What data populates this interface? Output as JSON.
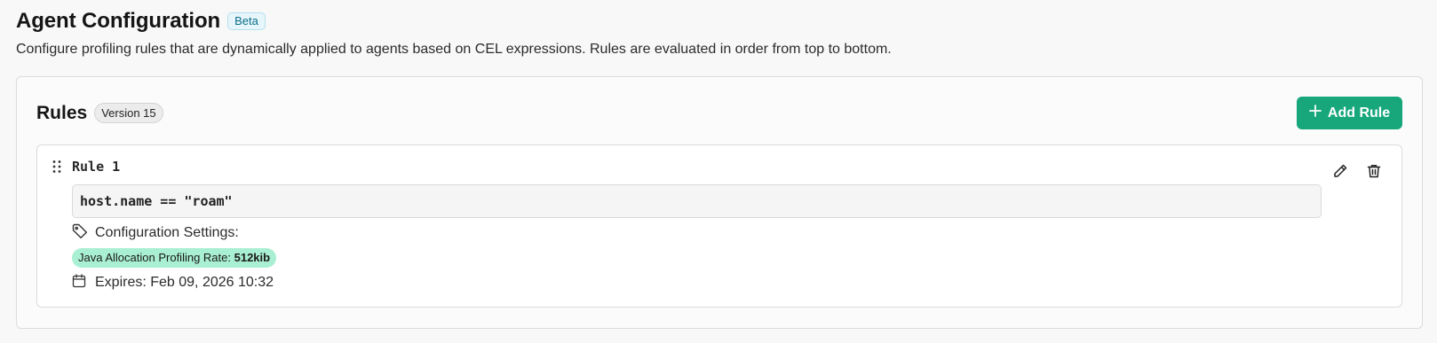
{
  "header": {
    "title": "Agent Configuration",
    "badge": "Beta",
    "description": "Configure profiling rules that are dynamically applied to agents based on CEL expressions. Rules are evaluated in order from top to bottom."
  },
  "rules_section": {
    "title": "Rules",
    "version_label": "Version 15",
    "add_button_label": "Add Rule",
    "rules": [
      {
        "name": "Rule 1",
        "expression": "host.name == \"roam\"",
        "config_label": "Configuration Settings:",
        "setting_name": "Java Allocation Profiling Rate:",
        "setting_value": "512kib",
        "expires": "Expires: Feb 09, 2026 10:32"
      }
    ]
  },
  "colors": {
    "accent": "#17a77a",
    "chip_background": "#a9efd3",
    "beta_badge_text": "#0b6f8a"
  },
  "icons": {
    "add": "plus-icon",
    "drag": "drag-handle-icon",
    "edit": "pencil-icon",
    "delete": "trash-icon",
    "config": "tag-icon",
    "expires": "calendar-icon"
  }
}
